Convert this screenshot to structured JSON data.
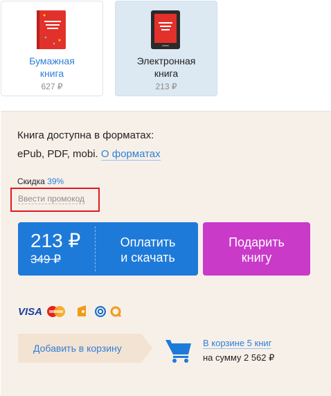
{
  "formats": [
    {
      "label_line1": "Бумажная",
      "label_line2": "книга",
      "price": "627 ₽"
    },
    {
      "label_line1": "Электронная",
      "label_line2": "книга",
      "price": "213 ₽"
    }
  ],
  "availability": {
    "line1": "Книга доступна в форматах:",
    "formats_text": "ePub, PDF, mobi.",
    "about_link": "О форматах"
  },
  "discount": {
    "label": "Скидка",
    "percent": "39%"
  },
  "promo": {
    "link": "Ввести промокод"
  },
  "pay_button": {
    "price": "213 ₽",
    "old_price": "349 ₽",
    "label_line1": "Оплатить",
    "label_line2": "и скачать"
  },
  "gift_button": {
    "label_line1": "Подарить",
    "label_line2": "книгу"
  },
  "payment_icons": [
    "visa-icon",
    "mastercard-icon",
    "yandex-money-icon",
    "webmoney-icon",
    "qiwi-icon"
  ],
  "cart": {
    "add_label": "Добавить в корзину",
    "count_link": "В корзине 5 книг",
    "total": "на сумму 2 562 ₽"
  },
  "colors": {
    "accent_blue": "#1e7ad9",
    "gift_purple": "#c93ac9",
    "panel_bg": "#f7f0e9",
    "highlight_red": "#e0181f"
  }
}
